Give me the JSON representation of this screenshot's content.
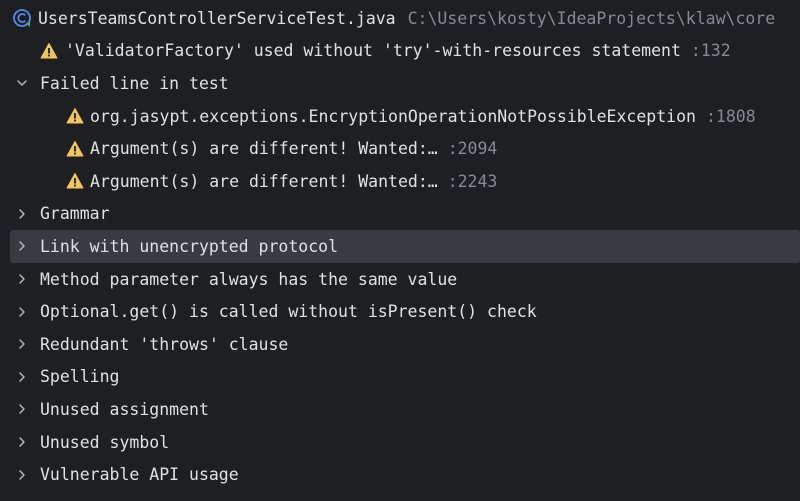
{
  "file": {
    "name": "UsersTeamsControllerServiceTest.java",
    "path": "C:\\Users\\kosty\\IdeaProjects\\klaw\\core"
  },
  "problems": [
    {
      "text": "'ValidatorFactory' used without 'try'-with-resources statement",
      "line": ":132"
    }
  ],
  "failed_group": {
    "label": "Failed line in test",
    "items": [
      {
        "text": "org.jasypt.exceptions.EncryptionOperationNotPossibleException",
        "line": ":1808"
      },
      {
        "text": "Argument(s) are different! Wanted:…",
        "line": ":2094"
      },
      {
        "text": "Argument(s) are different! Wanted:…",
        "line": ":2243"
      }
    ]
  },
  "categories": [
    {
      "label": "Grammar"
    },
    {
      "label": "Link with unencrypted protocol"
    },
    {
      "label": "Method parameter always has the same value"
    },
    {
      "label": "Optional.get() is called without isPresent() check"
    },
    {
      "label": "Redundant 'throws' clause"
    },
    {
      "label": "Spelling"
    },
    {
      "label": "Unused assignment"
    },
    {
      "label": "Unused symbol"
    },
    {
      "label": "Vulnerable API usage"
    }
  ],
  "selected_category": "Link with unencrypted protocol",
  "colors": {
    "background": "#1e1f22",
    "selection": "#393b40",
    "warning": "#f2c55c",
    "text": "#dfe1e5",
    "muted": "#868a91",
    "file_icon": "#548af7"
  },
  "icons": {
    "file": "java-test-class-icon",
    "warning": "warning-triangle-icon",
    "expanded": "chevron-down-icon",
    "collapsed": "chevron-right-icon"
  }
}
